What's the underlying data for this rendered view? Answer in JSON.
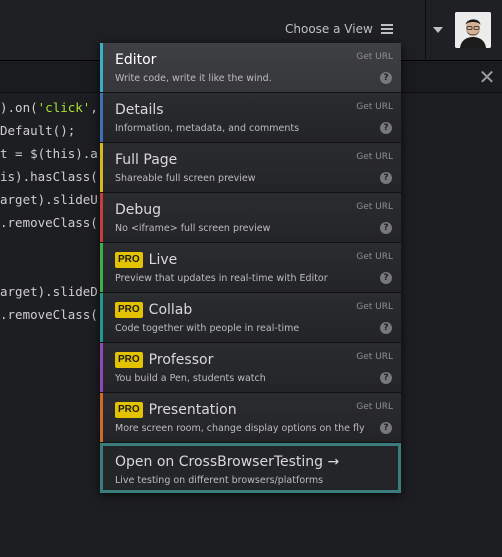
{
  "header": {
    "view_label": "Choose a View"
  },
  "code_lines": [
    {
      "pre": ").on(",
      "str": "'click'",
      "post": ","
    },
    {
      "pre": "Default();",
      "str": "",
      "post": ""
    },
    {
      "pre": "t = $(this).a",
      "str": "",
      "post": ""
    },
    {
      "pre": "is).hasClass(",
      "str": "",
      "post": ""
    },
    {
      "pre": "arget).slideU",
      "str": "",
      "post": ""
    },
    {
      "pre": ".removeClass(",
      "str": "",
      "post": ""
    },
    {
      "pre": "",
      "str": "",
      "post": ""
    },
    {
      "pre": "",
      "str": "",
      "post": ""
    },
    {
      "pre": "arget).slideD",
      "str": "",
      "post": ""
    },
    {
      "pre": ".removeClass(",
      "str": "",
      "post": ""
    }
  ],
  "menu": {
    "items": [
      {
        "title": "Editor",
        "desc": "Write code, write it like the wind.",
        "geturl": "Get URL",
        "pro": false,
        "stripe": "#3ab0c6",
        "active": true
      },
      {
        "title": "Details",
        "desc": "Information, metadata, and comments",
        "geturl": "Get URL",
        "pro": false,
        "stripe": "#3f6fb5",
        "active": false
      },
      {
        "title": "Full Page",
        "desc": "Shareable full screen preview",
        "geturl": "Get URL",
        "pro": false,
        "stripe": "#d9b51e",
        "active": false
      },
      {
        "title": "Debug",
        "desc": "No <iframe> full screen preview",
        "geturl": "Get URL",
        "pro": false,
        "stripe": "#c73c3c",
        "active": false
      },
      {
        "title": "Live",
        "desc": "Preview that updates in real-time with Editor",
        "geturl": "Get URL",
        "pro": true,
        "stripe": "#3fae49",
        "active": false
      },
      {
        "title": "Collab",
        "desc": "Code together with people in real-time",
        "geturl": "Get URL",
        "pro": true,
        "stripe": "#1f9a8a",
        "active": false
      },
      {
        "title": "Professor",
        "desc": "You build a Pen, students watch",
        "geturl": "Get URL",
        "pro": true,
        "stripe": "#8e49b8",
        "active": false
      },
      {
        "title": "Presentation",
        "desc": "More screen room, change display options on the fly",
        "geturl": "Get URL",
        "pro": true,
        "stripe": "#cf6a28",
        "active": false
      }
    ],
    "pro_label": "PRO",
    "help_glyph": "?",
    "cbt": {
      "title": "Open on CrossBrowserTesting →",
      "desc": "Live testing on different browsers/platforms"
    }
  }
}
